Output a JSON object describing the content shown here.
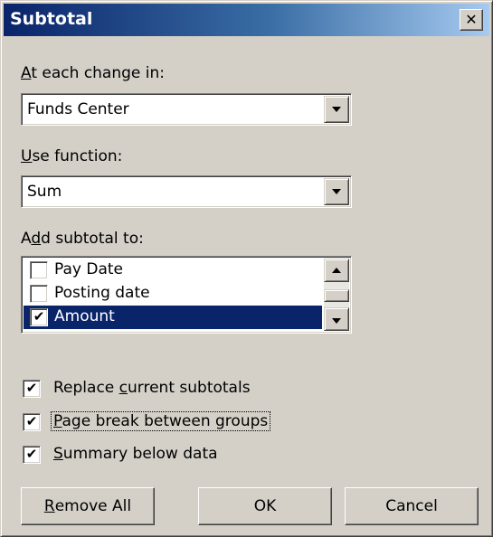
{
  "window": {
    "title": "Subtotal",
    "close_glyph": "✕"
  },
  "change_in": {
    "label_key": "A",
    "label_rest": "t each change in:",
    "value": "Funds Center"
  },
  "use_function": {
    "label_key": "U",
    "label_rest": "se function:",
    "value": "Sum"
  },
  "add_subtotal": {
    "label_pre": "A",
    "label_key": "d",
    "label_rest": "d subtotal to:",
    "items": [
      {
        "label": "Pay Date",
        "checked": false,
        "selected": false,
        "mark": ""
      },
      {
        "label": "Posting date",
        "checked": false,
        "selected": false,
        "mark": ""
      },
      {
        "label": "Amount",
        "checked": true,
        "selected": true,
        "mark": "✔"
      }
    ]
  },
  "options": [
    {
      "pre": "Replace ",
      "key": "c",
      "rest": "urrent subtotals",
      "checked": true,
      "mark": "✔"
    },
    {
      "pre": "",
      "key": "P",
      "rest": "age break between groups",
      "checked": true,
      "mark": "✔"
    },
    {
      "pre": "",
      "key": "S",
      "rest": "ummary below data",
      "checked": true,
      "mark": "✔"
    }
  ],
  "buttons": {
    "remove_all_key": "R",
    "remove_all_rest": "emove All",
    "ok": "OK",
    "cancel": "Cancel"
  },
  "colors": {
    "face": "#d4d0c8",
    "titlebar_start": "#0a246a",
    "titlebar_end": "#a6caf0",
    "selection": "#0a246a"
  },
  "icons": {
    "close": "close-icon",
    "dropdown": "chevron-down-icon",
    "scroll_up": "chevron-up-icon",
    "check": "checkmark-icon"
  }
}
